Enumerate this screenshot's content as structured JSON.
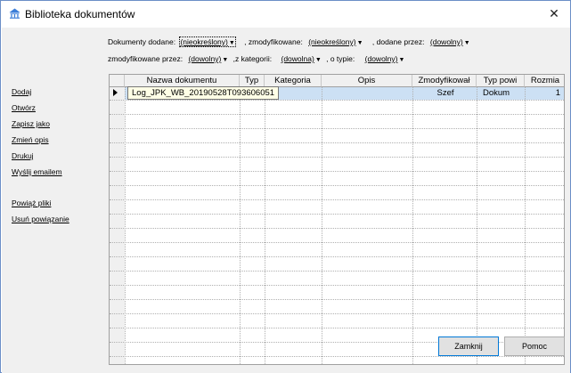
{
  "window": {
    "title": "Biblioteka dokumentów",
    "close_glyph": "✕",
    "icon": "library-house-icon"
  },
  "filters": {
    "dodane_label": "Dokumenty dodane:",
    "dodane_value": "(nieokreślony)",
    "zmodyfikowane_label": ", zmodyfikowane:",
    "zmodyfikowane_value": "(nieokreślony)",
    "dodane_przez_label": ", dodane przez:",
    "dodane_przez_value": "(dowolny)",
    "zmodyfikowane_przez_label": "zmodyfikowane przez:",
    "zmodyfikowane_przez_value": "(dowolny)",
    "kategorii_label": ",z kategorii:",
    "kategorii_value": "(dowolna)",
    "typie_label": ", o typie:",
    "typie_value": "(dowolny)",
    "arrow": "▼"
  },
  "actions": [
    "Dodaj",
    "Otwórz",
    "Zapisz jako",
    "Zmień opis",
    "Drukuj",
    "Wyślij emailem",
    "Powiąż pliki",
    "Usuń powiązanie"
  ],
  "grid": {
    "columns": [
      "Nazwa dokumentu",
      "Typ",
      "Kategoria",
      "Opis",
      "Zmodyfikował",
      "Typ powi",
      "Rozmia"
    ],
    "rows": [
      {
        "name": "Log_JPK_WB_20190528T093606051",
        "typ": "",
        "kategoria": "",
        "opis": "",
        "zmodyfikowal": "Szef",
        "typ_powiazania": "Dokum",
        "rozmiar": "1"
      }
    ]
  },
  "buttons": {
    "close": "Zamknij",
    "help": "Pomoc"
  }
}
